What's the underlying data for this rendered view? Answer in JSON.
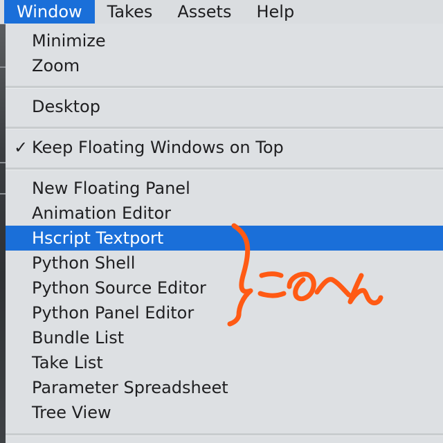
{
  "menubar": {
    "items": [
      {
        "label": "Window",
        "active": true
      },
      {
        "label": "Takes"
      },
      {
        "label": "Assets"
      },
      {
        "label": "Help"
      }
    ]
  },
  "window_menu": {
    "group1": [
      "Minimize",
      "Zoom"
    ],
    "group2": [
      "Desktop"
    ],
    "group3": {
      "label": "Keep Floating Windows on Top",
      "checked": true,
      "check_glyph": "✓"
    },
    "group4": [
      "New Floating Panel",
      "Animation Editor",
      "Hscript Textport",
      "Python Shell",
      "Python Source Editor",
      "Python Panel Editor",
      "Bundle List",
      "Take List",
      "Parameter Spreadsheet",
      "Tree View"
    ],
    "highlighted_item": "Hscript Textport"
  },
  "annotation": {
    "text": "このへん",
    "color": "#ff5a14"
  },
  "colors": {
    "highlight": "#1a6fd9",
    "menu_bg": "#dde0e3",
    "text": "#1f1f21"
  }
}
